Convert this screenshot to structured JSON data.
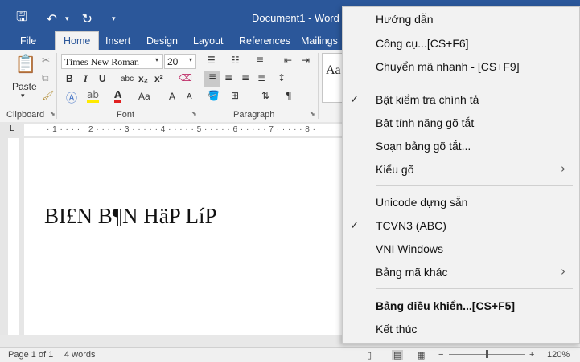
{
  "app": {
    "document_title": "Document1 - Word",
    "qat": {
      "save_icon": "save-icon",
      "undo_icon": "undo-icon",
      "redo_icon": "redo-icon"
    }
  },
  "tabs": [
    "File",
    "Home",
    "Insert",
    "Design",
    "Layout",
    "References",
    "Mailings"
  ],
  "ribbon": {
    "clipboard": {
      "paste_label": "Paste",
      "group_label": "Clipboard"
    },
    "font": {
      "font_name": "Times New Roman",
      "font_size": "20",
      "group_label": "Font",
      "bold": "B",
      "italic": "I",
      "underline": "U",
      "strike": "abc",
      "subscript": "x₂",
      "superscript": "x²",
      "grow": "A",
      "shrink": "A",
      "case": "Aa"
    },
    "paragraph": {
      "group_label": "Paragraph",
      "pilcrow": "¶"
    },
    "styles": {
      "preview": "Aa"
    }
  },
  "ruler": {
    "marks": "· 1 · · · · · 2 · · · · · 3 · · · · · 4 · · · · · 5 · · · · · 6 · · · · · 7 · · · · · 8 ·"
  },
  "document": {
    "text": "BI£N B¶N HäP LíP"
  },
  "status": {
    "page": "Page 1 of 1",
    "words": "4 words",
    "zoom": "120%",
    "zoom_minus": "−",
    "zoom_plus": "+"
  },
  "menu": {
    "items": [
      {
        "label": "Hướng dẫn"
      },
      {
        "label": "Công cụ...[CS+F6]"
      },
      {
        "label": "Chuyển mã nhanh - [CS+F9]"
      },
      {
        "label": "Bật kiểm tra chính tả",
        "check": "✓"
      },
      {
        "label": "Bật tính năng gõ tắt"
      },
      {
        "label": "Soạn bảng gõ tắt..."
      },
      {
        "label": "Kiểu gõ",
        "arrow": "›"
      },
      {
        "label": "Unicode dựng sẵn"
      },
      {
        "label": "TCVN3 (ABC)",
        "check": "✓"
      },
      {
        "label": "VNI Windows"
      },
      {
        "label": "Bảng mã khác",
        "arrow": "›"
      },
      {
        "label": "Bảng điều khiển...[CS+F5]"
      },
      {
        "label": "Kết thúc"
      }
    ]
  }
}
